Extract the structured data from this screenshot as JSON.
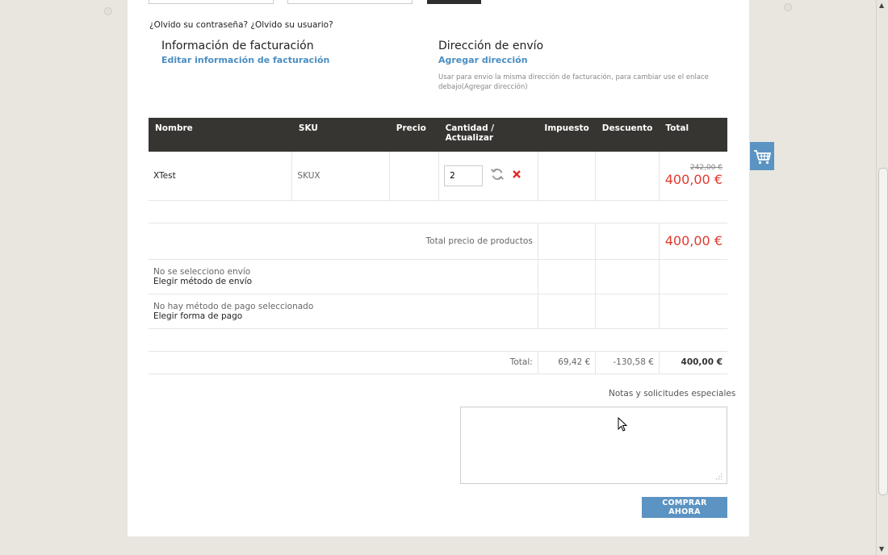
{
  "login": {
    "forgot_text": "¿Olvido su contraseña? ¿Olvido su usuario?"
  },
  "billing": {
    "title": "Información de facturación",
    "edit_link": "Editar información de facturación"
  },
  "shipping": {
    "title": "Dirección de envío",
    "add_link": "Agregar dirección",
    "note": "Usar para envio la misma dirección de facturación, para cambiar use el enlace debajo(Agregar dirección)"
  },
  "cart": {
    "headers": {
      "name": "Nombre",
      "sku": "SKU",
      "price": "Precio",
      "quantity": "Cantidad / Actualizar",
      "tax": "Impuesto",
      "discount": "Descuento",
      "total": "Total"
    },
    "items": [
      {
        "name": "XTest",
        "sku": "SKUX",
        "quantity": "2",
        "old_total": "242,00 €",
        "total": "400,00 €"
      }
    ],
    "products_total_label": "Total precio de productos",
    "products_total_value": "400,00 €",
    "shipping_status": "No se selecciono envío",
    "shipping_choose": "Elegir método de envío",
    "payment_status": "No hay método de pago seleccionado",
    "payment_choose": "Elegir forma de pago",
    "grand_total_label": "Total:",
    "grand_total_tax": "69,42 €",
    "grand_total_discount": "-130,58 €",
    "grand_total_value": "400,00 €"
  },
  "notes": {
    "label": "Notas y solicitudes especiales",
    "value": ""
  },
  "actions": {
    "buy_now": "COMPRAR AHORA"
  },
  "colors": {
    "accent": "#5b93c2",
    "link": "#4a8ec2",
    "price_red": "#e03a2f",
    "table_header": "#373532",
    "page_background": "#e8e6df"
  },
  "icons": {
    "refresh": "refresh-icon",
    "remove": "remove-icon",
    "cart": "shopping-cart-icon"
  }
}
